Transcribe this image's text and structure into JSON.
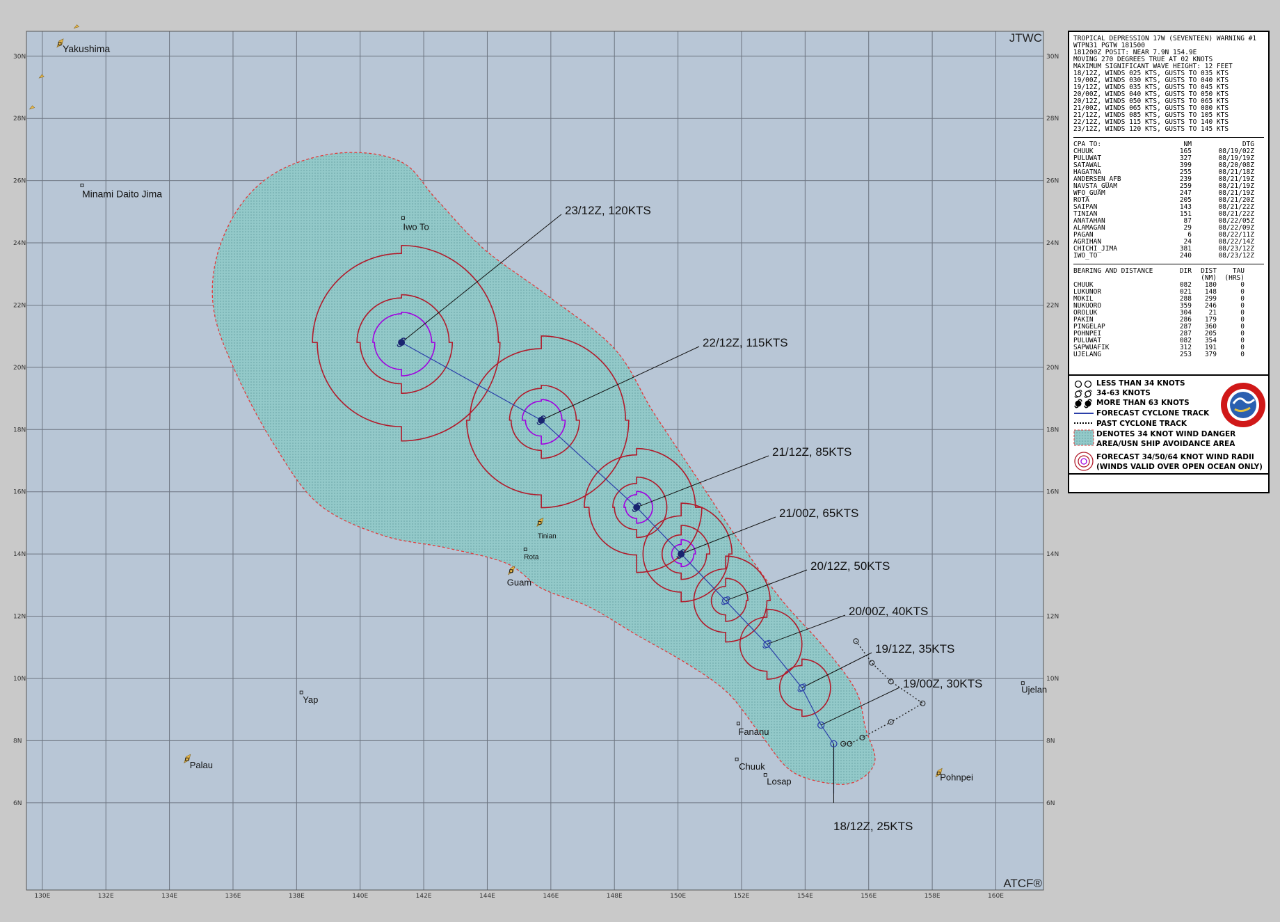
{
  "header": {
    "agency": "JTWC",
    "footer": "ATCF®"
  },
  "map": {
    "lon_range": [
      129.5,
      161.5
    ],
    "lat_range": [
      3.2,
      30.8
    ],
    "lon_labels": [
      "130E",
      "132E",
      "134E",
      "136E",
      "138E",
      "140E",
      "142E",
      "144E",
      "146E",
      "148E",
      "150E",
      "152E",
      "154E",
      "156E",
      "158E",
      "160E"
    ],
    "lat_labels": [
      "6N",
      "8N",
      "10N",
      "12N",
      "14N",
      "16N",
      "18N",
      "20N",
      "22N",
      "24N",
      "26N",
      "28N",
      "30N"
    ],
    "places": [
      {
        "name": "Yakushima",
        "lat": 30.4,
        "lon": 130.55
      },
      {
        "name": "Minami Daito Jima",
        "lat": 25.85,
        "lon": 131.25
      },
      {
        "name": "Iwo To",
        "lat": 24.8,
        "lon": 141.35
      },
      {
        "name": "Tinian",
        "lat": 15.0,
        "lon": 145.65
      },
      {
        "name": "Rota",
        "lat": 14.15,
        "lon": 145.2
      },
      {
        "name": "Guam",
        "lat": 13.45,
        "lon": 144.75
      },
      {
        "name": "Yap",
        "lat": 9.55,
        "lon": 138.15
      },
      {
        "name": "Palau",
        "lat": 7.4,
        "lon": 134.55
      },
      {
        "name": "Fananu",
        "lat": 8.55,
        "lon": 151.9
      },
      {
        "name": "Chuuk",
        "lat": 7.4,
        "lon": 151.85
      },
      {
        "name": "Losap",
        "lat": 6.9,
        "lon": 152.75
      },
      {
        "name": "Pohnpei",
        "lat": 6.95,
        "lon": 158.2
      },
      {
        "name": "Ujelan",
        "lat": 9.85,
        "lon": 160.85
      }
    ],
    "forecast_points": [
      {
        "label": "18/12Z, 25KTS",
        "lat": 7.9,
        "lon": 154.9,
        "kts": 25
      },
      {
        "label": "19/00Z, 30KTS",
        "lat": 8.5,
        "lon": 154.5,
        "kts": 30
      },
      {
        "label": "19/12Z, 35KTS",
        "lat": 9.7,
        "lon": 153.9,
        "kts": 35
      },
      {
        "label": "20/00Z, 40KTS",
        "lat": 11.1,
        "lon": 152.8,
        "kts": 40
      },
      {
        "label": "20/12Z, 50KTS",
        "lat": 12.5,
        "lon": 151.5,
        "kts": 50
      },
      {
        "label": "21/00Z, 65KTS",
        "lat": 14.0,
        "lon": 150.1,
        "kts": 65
      },
      {
        "label": "21/12Z, 85KTS",
        "lat": 15.5,
        "lon": 148.7,
        "kts": 85
      },
      {
        "label": "22/12Z, 115KTS",
        "lat": 18.3,
        "lon": 145.7,
        "kts": 115
      },
      {
        "label": "23/12Z, 120KTS",
        "lat": 20.8,
        "lon": 141.3,
        "kts": 120
      }
    ],
    "past_track": [
      {
        "lat": 7.9,
        "lon": 155.2
      },
      {
        "lat": 7.9,
        "lon": 155.4
      },
      {
        "lat": 8.1,
        "lon": 155.8
      },
      {
        "lat": 8.6,
        "lon": 156.7
      },
      {
        "lat": 9.2,
        "lon": 157.7
      },
      {
        "lat": 9.9,
        "lon": 156.7
      },
      {
        "lat": 10.5,
        "lon": 156.1
      },
      {
        "lat": 11.2,
        "lon": 155.6
      }
    ]
  },
  "info": {
    "lines": [
      "TROPICAL DEPRESSION 17W (SEVENTEEN) WARNING #1",
      "WTPN31 PGTW 181500",
      "181200Z POSIT: NEAR 7.9N 154.9E",
      "MOVING 270 DEGREES TRUE AT 02 KNOTS",
      "MAXIMUM SIGNIFICANT WAVE HEIGHT: 12 FEET",
      "18/12Z, WINDS 025 KTS, GUSTS TO 035 KTS",
      "19/00Z, WINDS 030 KTS, GUSTS TO 040 KTS",
      "19/12Z, WINDS 035 KTS, GUSTS TO 045 KTS",
      "20/00Z, WINDS 040 KTS, GUSTS TO 050 KTS",
      "20/12Z, WINDS 050 KTS, GUSTS TO 065 KTS",
      "21/00Z, WINDS 065 KTS, GUSTS TO 080 KTS",
      "21/12Z, WINDS 085 KTS, GUSTS TO 105 KTS",
      "22/12Z, WINDS 115 KTS, GUSTS TO 140 KTS",
      "23/12Z, WINDS 120 KTS, GUSTS TO 145 KTS"
    ],
    "cpa": {
      "headers": [
        "CPA TO:",
        "NM",
        "DTG"
      ],
      "rows": [
        [
          "CHUUK",
          "165",
          "08/19/02Z"
        ],
        [
          "PULUWAT",
          "327",
          "08/19/19Z"
        ],
        [
          "SATAWAL",
          "399",
          "08/20/08Z"
        ],
        [
          "HAGATNA",
          "255",
          "08/21/18Z"
        ],
        [
          "ANDERSEN_AFB",
          "239",
          "08/21/19Z"
        ],
        [
          "NAVSTA_GUAM",
          "259",
          "08/21/19Z"
        ],
        [
          "WFO_GUAM",
          "247",
          "08/21/19Z"
        ],
        [
          "ROTA",
          "205",
          "08/21/20Z"
        ],
        [
          "SAIPAN",
          "143",
          "08/21/22Z"
        ],
        [
          "TINIAN",
          "151",
          "08/21/22Z"
        ],
        [
          "ANATAHAN",
          "87",
          "08/22/05Z"
        ],
        [
          "ALAMAGAN",
          "29",
          "08/22/09Z"
        ],
        [
          "PAGAN",
          "6",
          "08/22/11Z"
        ],
        [
          "AGRIHAN",
          "24",
          "08/22/14Z"
        ],
        [
          "CHICHI_JIMA",
          "381",
          "08/23/12Z"
        ],
        [
          "IWO_TO",
          "240",
          "08/23/12Z"
        ]
      ]
    },
    "bearing": {
      "header": "BEARING AND DISTANCE",
      "col_headers": [
        "DIR",
        "DIST",
        "TAU"
      ],
      "units": [
        "(NM)",
        "(HRS)"
      ],
      "rows": [
        [
          "CHUUK",
          "082",
          "180",
          "0"
        ],
        [
          "LUKUNOR",
          "021",
          "148",
          "0"
        ],
        [
          "MOKIL",
          "288",
          "299",
          "0"
        ],
        [
          "NUKUORO",
          "359",
          "246",
          "0"
        ],
        [
          "OROLUK",
          "304",
          "21",
          "0"
        ],
        [
          "PAKIN",
          "286",
          "179",
          "0"
        ],
        [
          "PINGELAP",
          "287",
          "360",
          "0"
        ],
        [
          "POHNPEI",
          "287",
          "205",
          "0"
        ],
        [
          "PULUWAT",
          "082",
          "354",
          "0"
        ],
        [
          "SAPWUAFIK",
          "312",
          "191",
          "0"
        ],
        [
          "UJELANG",
          "253",
          "379",
          "0"
        ]
      ]
    }
  },
  "legend": {
    "items": [
      "LESS THAN 34 KNOTS",
      "34-63 KNOTS",
      "MORE THAN 63 KNOTS",
      "FORECAST CYCLONE TRACK",
      "PAST CYCLONE TRACK",
      "DENOTES 34 KNOT WIND DANGER",
      "AREA/USN SHIP AVOIDANCE AREA",
      "FORECAST 34/50/64 KNOT WIND RADII",
      "(WINDS VALID OVER OPEN OCEAN ONLY)"
    ],
    "colors": {
      "ocean": "#b8c6d6",
      "danger_fill": "#8ec9c8",
      "danger_edge": "#e23b3b",
      "radii": "#b11a2a",
      "radii64": "#a000e0",
      "track": "#2b3fa8",
      "land": "#e8b84a"
    }
  }
}
